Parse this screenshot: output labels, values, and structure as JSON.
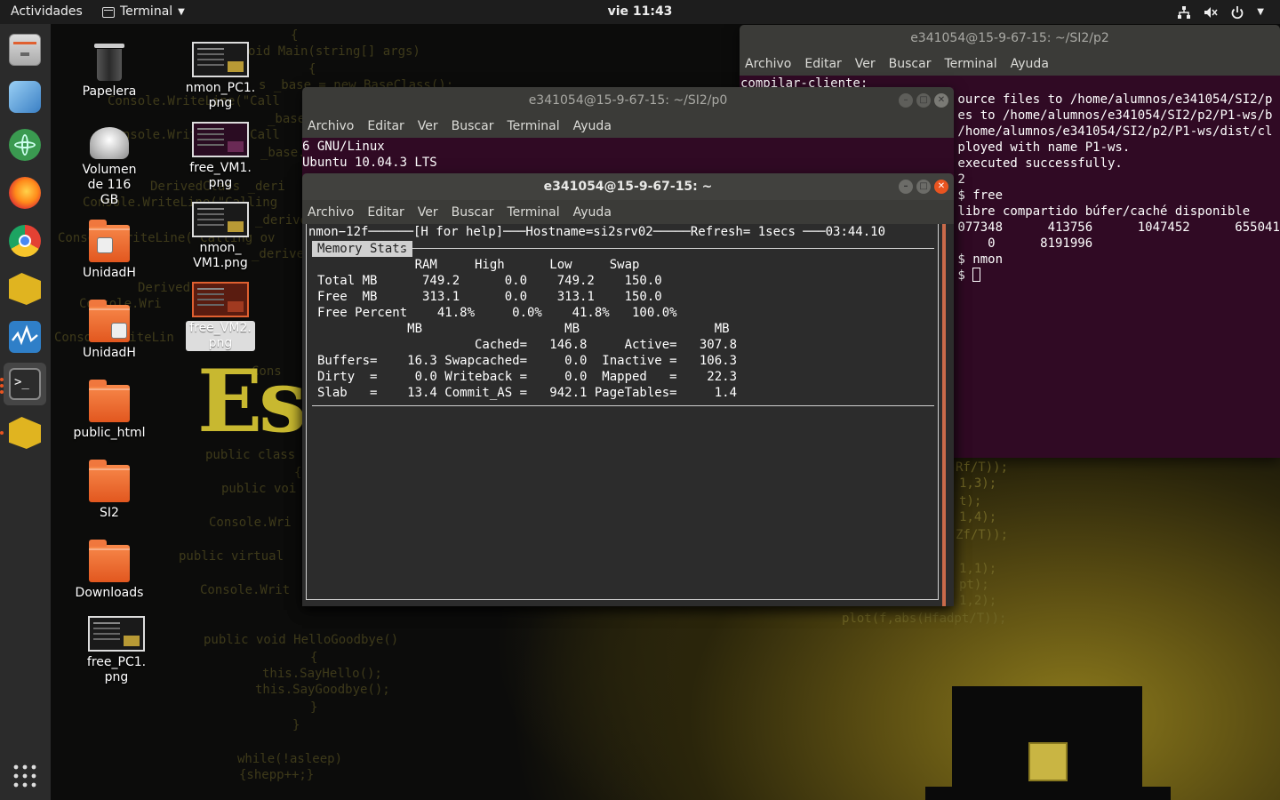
{
  "topbar": {
    "activities": "Actividades",
    "app_name": "Terminal",
    "clock": "vie 11:43"
  },
  "dock": {
    "items": [
      "files-icon",
      "3d-cube-icon",
      "atom-icon",
      "firefox-icon",
      "chrome-icon",
      "vm-icon",
      "monitor-icon",
      "terminal-icon",
      "vm-icon-2"
    ],
    "apps_grid": "show-applications-icon"
  },
  "desktop": {
    "icons": [
      {
        "label": "Papelera"
      },
      {
        "label": "Volumen de 116 GB"
      },
      {
        "label": "UnidadH"
      },
      {
        "label": "UnidadH"
      },
      {
        "label": "public_html"
      },
      {
        "label": "SI2"
      },
      {
        "label": "Downloads"
      },
      {
        "label": "free_PC1.\npng"
      },
      {
        "label": "nmon_PC1.\npng"
      },
      {
        "label": "free_VM1.\npng"
      },
      {
        "label": "nmon_\nVM1.png"
      },
      {
        "label": "free_VM2.\npng"
      }
    ],
    "wallpaper_code": [
      "{",
      "oid Main(string[] args)",
      "{",
      "s _base = new BaseClass();",
      "Console.WriteLine(\"Call",
      "_base.",
      "Console.WriteLine(\"Call",
      "_base.",
      "DerivedClass _deri",
      "Console.WriteLine(\"Calling",
      "_derive",
      "Console.WriteLine(\"Calling ov",
      "_derive",
      "Derived",
      "Console.Wri",
      "Console.WriteLin",
      "Cons",
      "public class",
      "{",
      "public voi",
      "Console.Wri",
      "public virtual",
      "Console.Writ",
      "public void HelloGoodbye()",
      "{",
      "this.SayHello();",
      "this.SayGoodbye();",
      "}",
      "}",
      "while(!asleep)",
      "{shepp++;}"
    ],
    "wallpaper_code_right": [
      "Rf/T));",
      "1,3);",
      "t);",
      "1,4);",
      "Zf/T));",
      "1,1);",
      "pt);",
      "1,2);",
      "plot(f,abs(Hfadpt/T));"
    ],
    "big_text": "Esc"
  },
  "windows": {
    "back": {
      "title": "e341054@15-9-67-15: ~/SI2/p2",
      "menu": [
        "Archivo",
        "Editar",
        "Ver",
        "Buscar",
        "Terminal",
        "Ayuda"
      ],
      "lines": [
        "compilar-cliente:",
        "                             ource files to /home/alumnos/e341054/SI2/p",
        "",
        "",
        "                             es to /home/alumnos/e341054/SI2/p2/P1-ws/b",
        "",
        "",
        "                             /home/alumnos/e341054/SI2/p2/P1-ws/dist/cl",
        "",
        "",
        "                             ployed with name P1-ws.",
        "                             executed successfully.",
        "",
        "",
        "                             2",
        "                             $ free",
        "                             libre compartido búfer/caché disponible",
        "                             077348      413756      1047452      655041",
        "                                 0      8191996",
        "                             $ nmon",
        "                             $ "
      ]
    },
    "middle": {
      "title": "e341054@15-9-67-15: ~/SI2/p0",
      "menu": [
        "Archivo",
        "Editar",
        "Ver",
        "Buscar",
        "Terminal",
        "Ayuda"
      ],
      "lines": [
        "6 GNU/Linux",
        "Ubuntu 10.04.3 LTS"
      ]
    },
    "front": {
      "title": "e341054@15-9-67-15: ~",
      "menu": [
        "Archivo",
        "Editar",
        "Ver",
        "Buscar",
        "Terminal",
        "Ayuda"
      ],
      "nmon": {
        "header": "nmon−12f──────[H for help]───Hostname=si2srv02─────Refresh= 1secs ───03:44.10",
        "section_label": "Memory Stats",
        "rows": [
          "             RAM     High      Low     Swap",
          "Total MB      749.2      0.0    749.2    150.0",
          "Free  MB      313.1      0.0    313.1    150.0",
          "Free Percent    41.8%     0.0%    41.8%   100.0%",
          "            MB                   MB                  MB",
          "                     Cached=   146.8     Active=   307.8",
          "Buffers=    16.3 Swapcached=     0.0  Inactive =   106.3",
          "Dirty  =     0.0 Writeback =     0.0  Mapped   =    22.3",
          "Slab   =    13.4 Commit_AS =   942.1 PageTables=     1.4"
        ]
      }
    }
  },
  "colors": {
    "terminal_bg": "#300a24",
    "accent": "#e95420",
    "titlebar": "#3b3b38"
  }
}
